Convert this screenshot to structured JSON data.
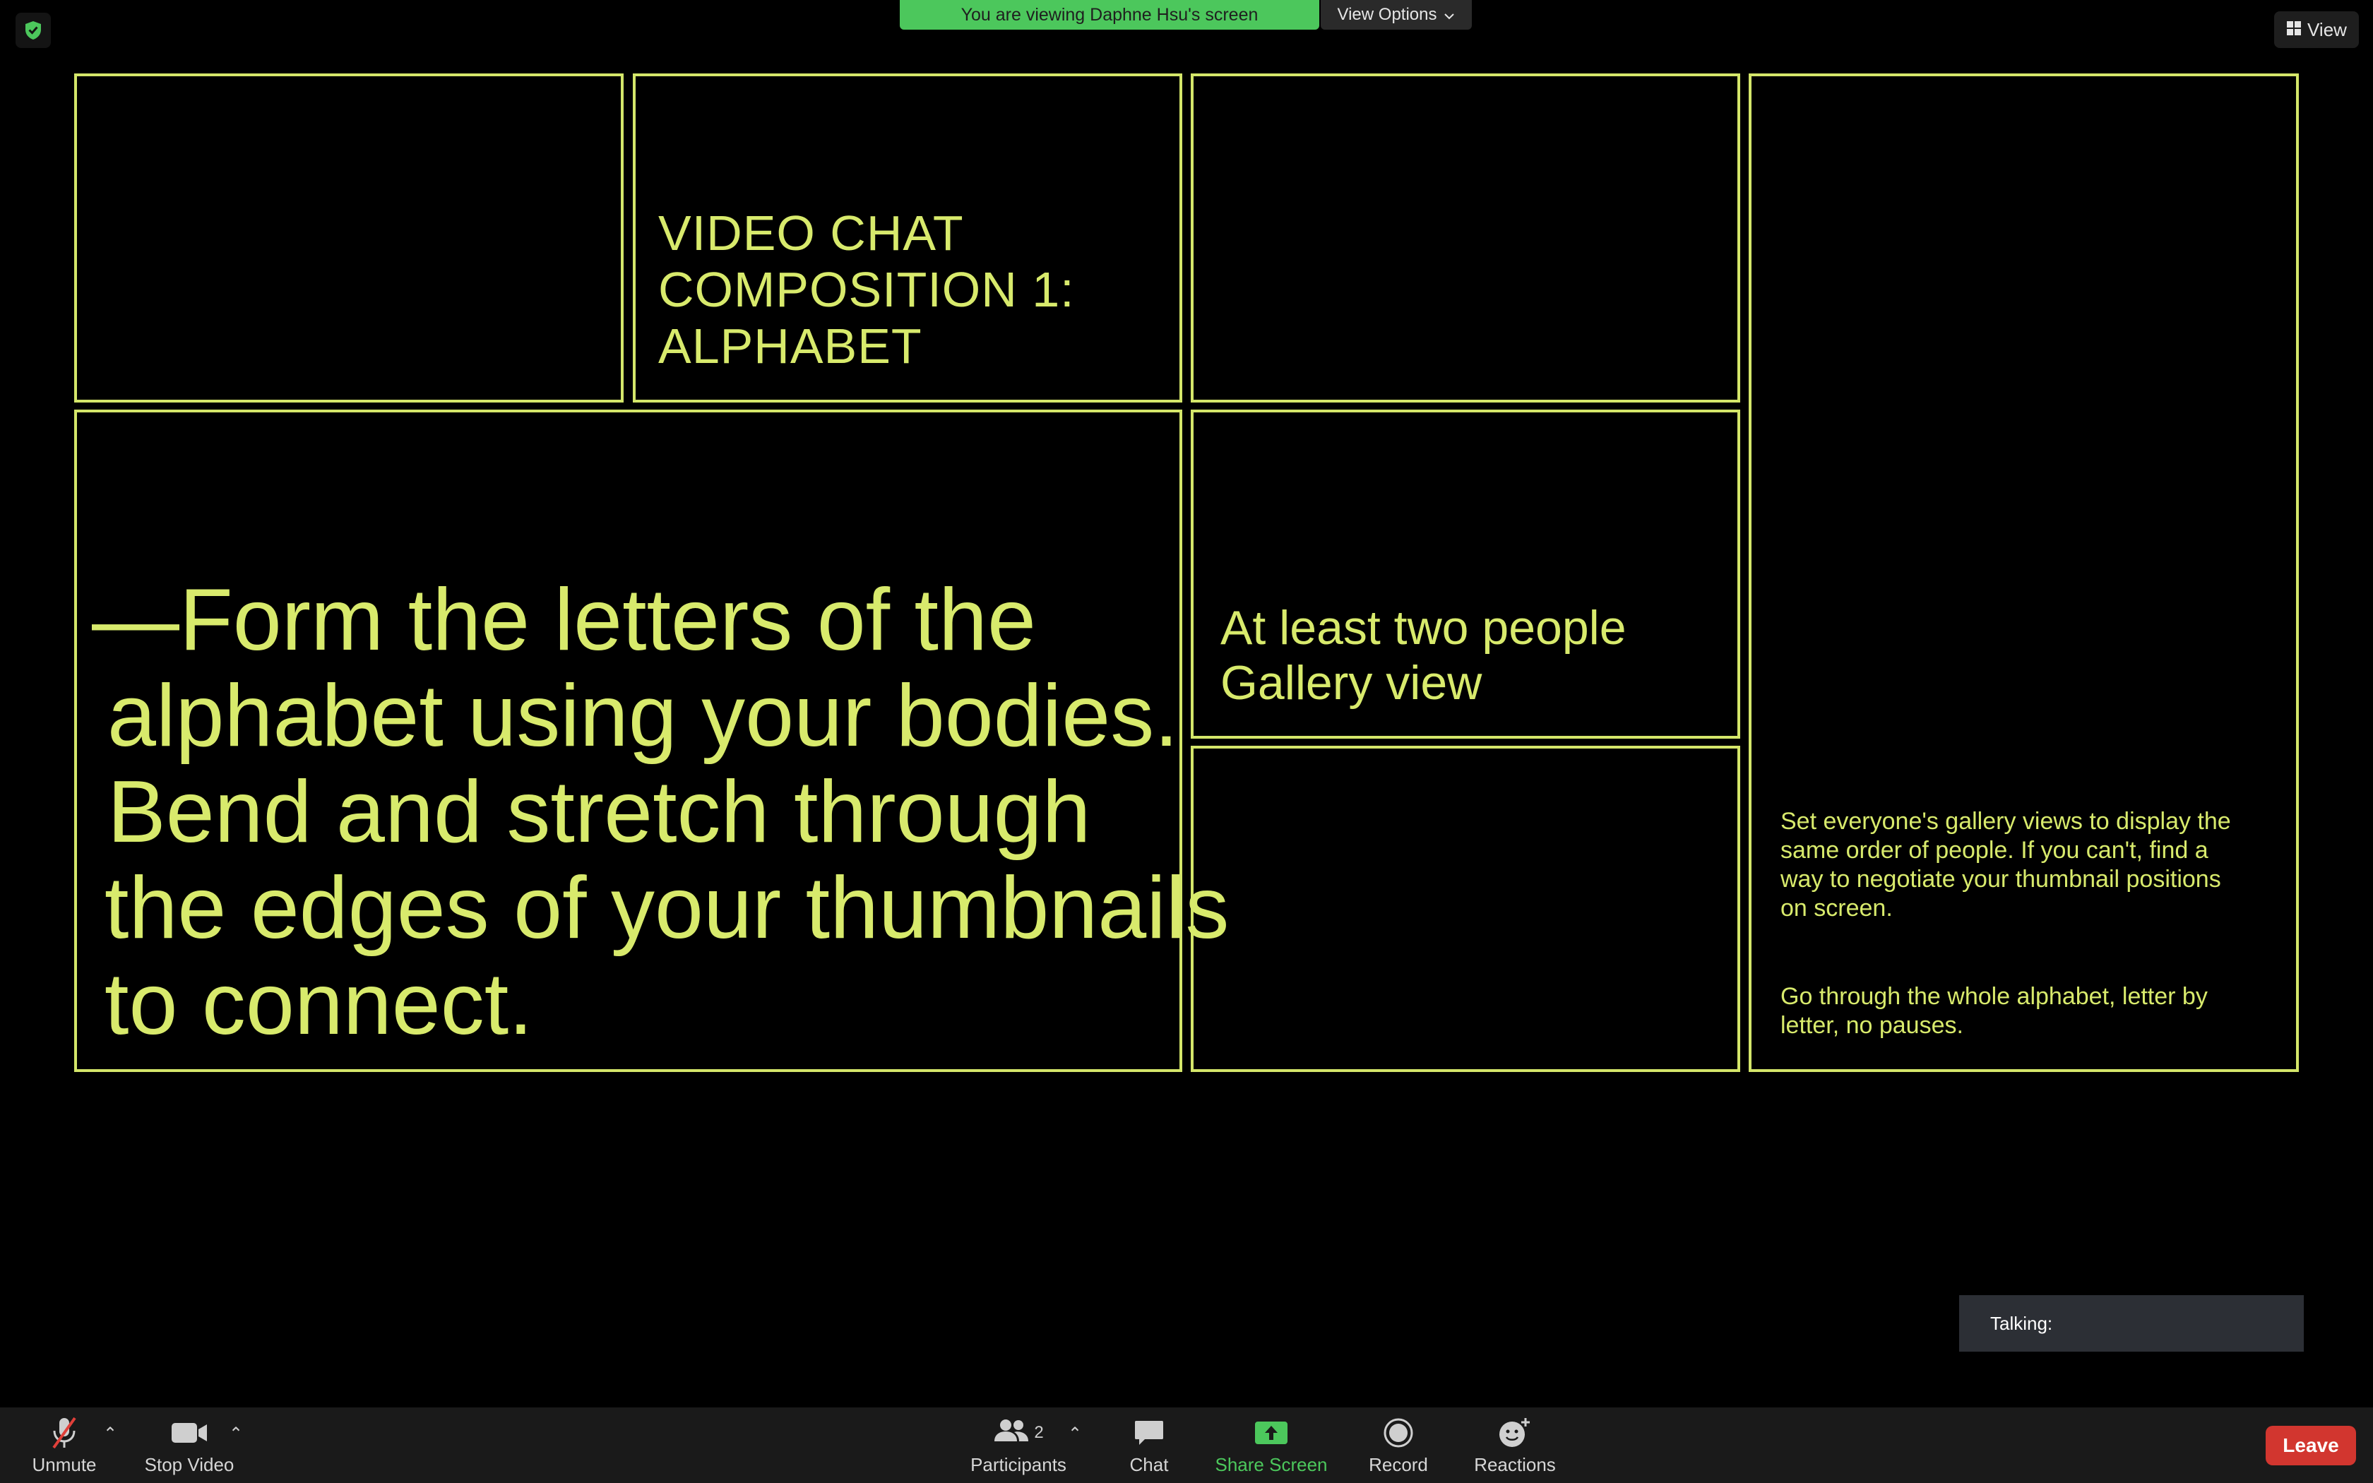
{
  "banner": {
    "viewing_text": "You are viewing Daphne Hsu's screen",
    "view_options_label": "View Options",
    "view_button_label": "View"
  },
  "slide": {
    "title_lines": [
      "VIDEO CHAT",
      "COMPOSITION 1:",
      "ALPHABET"
    ],
    "instruction_lines": [
      "—Form the letters of the",
      "alphabet using your bodies.",
      "Bend and stretch through",
      "the edges of your thumbnails",
      "to connect."
    ],
    "requirements_lines": [
      "At least two people",
      "Gallery view"
    ],
    "gallery_note": "Set everyone's gallery views to display the same order of people. If you can't, find a way to negotiate your thumbnail positions on screen.",
    "alphabet_note": "Go through the whole alphabet, letter by letter, no pauses.",
    "accent_color": "#d4e66a"
  },
  "talking": {
    "label": "Talking:"
  },
  "toolbar": {
    "unmute_label": "Unmute",
    "stop_video_label": "Stop Video",
    "participants_label": "Participants",
    "participants_count": "2",
    "chat_label": "Chat",
    "share_screen_label": "Share Screen",
    "record_label": "Record",
    "reactions_label": "Reactions",
    "leave_label": "Leave"
  },
  "colors": {
    "banner_green": "#4cc75c",
    "share_green": "#4cc75c",
    "leave_red": "#d2362f"
  }
}
